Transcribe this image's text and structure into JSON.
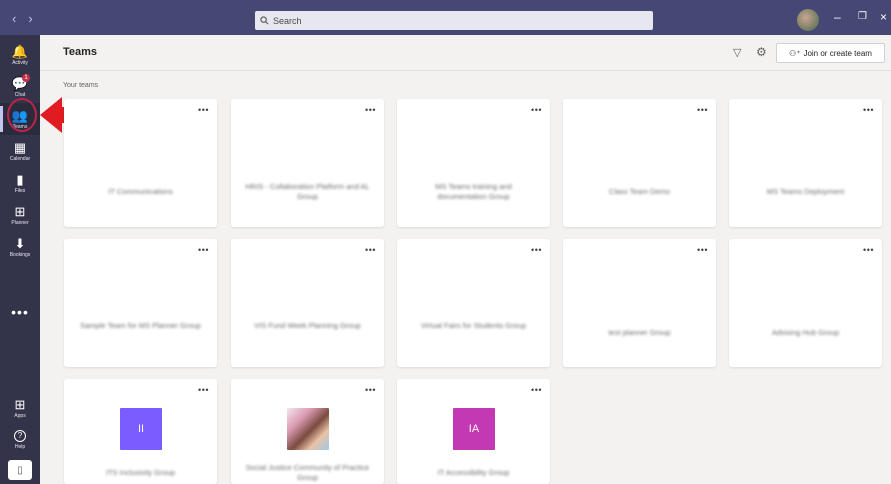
{
  "titlebar": {
    "back_glyph": "‹",
    "forward_glyph": "›",
    "search_placeholder": "Search",
    "minimize_glyph": "–",
    "restore_glyph": "❐",
    "close_glyph": "×"
  },
  "rail": {
    "items": [
      {
        "label": "Activity",
        "glyph": "🔔"
      },
      {
        "label": "Chat",
        "glyph": "💬",
        "badge": "1"
      },
      {
        "label": "Teams",
        "glyph": "👥"
      },
      {
        "label": "Calendar",
        "glyph": "▦"
      },
      {
        "label": "Files",
        "glyph": "▮"
      },
      {
        "label": "Planner",
        "glyph": "⊞"
      },
      {
        "label": "Bookings",
        "glyph": "⬇"
      }
    ],
    "more_glyph": "•••",
    "apps_label": "Apps",
    "apps_glyph": "⊞",
    "help_label": "Help",
    "help_glyph": "?",
    "device_glyph": "▯"
  },
  "header": {
    "title": "Teams",
    "join_label": "Join or create team"
  },
  "section": {
    "label": "Your teams"
  },
  "teams": [
    {
      "name": "IT Communications",
      "more": "•••"
    },
    {
      "name": "HRIS - Collaboration Platform and AL Group",
      "more": "•••"
    },
    {
      "name": "MS Teams training and documentation Group",
      "more": "•••"
    },
    {
      "name": "Class Team Demo",
      "more": "•••"
    },
    {
      "name": "MS Teams Deployment",
      "more": "•••"
    },
    {
      "name": "Sample Team for MS Planner Group",
      "more": "•••"
    },
    {
      "name": "VIS Fund Week Planning Group",
      "more": "•••"
    },
    {
      "name": "Virtual Fairs for Students Group",
      "more": "•••"
    },
    {
      "name": "test planner Group",
      "more": "•••"
    },
    {
      "name": "Advising Hub Group",
      "more": "•••"
    },
    {
      "name": "ITS Inclusivity Group",
      "more": "•••",
      "tile_text": "II",
      "tile_color": "#7b5cff"
    },
    {
      "name": "Social Justice Community of Practice Group",
      "more": "•••",
      "tile_text": ""
    },
    {
      "name": "IT Accessibility Group",
      "more": "•••",
      "tile_text": "IA",
      "tile_color": "#c239b3"
    }
  ],
  "colors": {
    "titlebar": "#464775",
    "rail": "#33344a",
    "highlight": "#e01b22"
  }
}
